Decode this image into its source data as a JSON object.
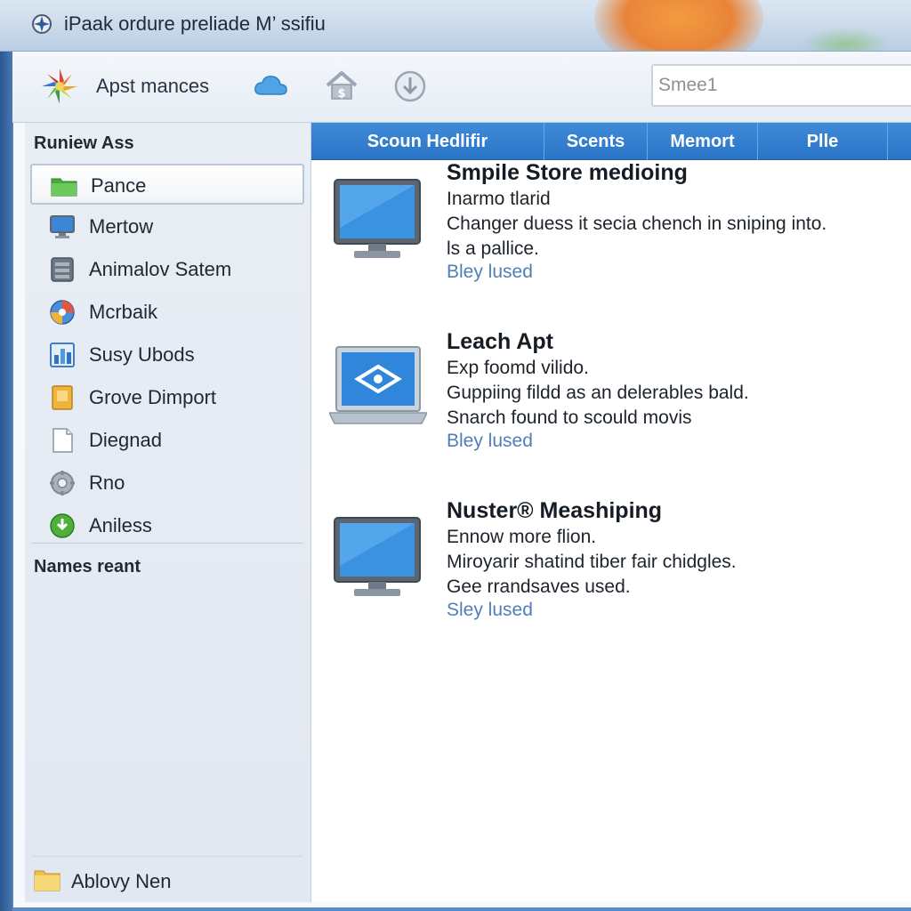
{
  "window": {
    "title": "iPaak ordure preliade M’ ssifiu"
  },
  "toolbar": {
    "app_label": "Apst mances",
    "search_placeholder": "Smee1",
    "icons": [
      "app-logo-icon",
      "cloud-icon",
      "home-icon",
      "download-icon"
    ]
  },
  "sidebar": {
    "heading": "Runiew Ass",
    "items": [
      {
        "label": "Pance",
        "icon": "folder-icon",
        "selected": true
      },
      {
        "label": "Mertow",
        "icon": "monitor-icon",
        "selected": false
      },
      {
        "label": "Animalov Satem",
        "icon": "drive-icon",
        "selected": false
      },
      {
        "label": "Mcrbaik",
        "icon": "globe-icon",
        "selected": false
      },
      {
        "label": "Susy Ubods",
        "icon": "chart-icon",
        "selected": false
      },
      {
        "label": "Grove Dimport",
        "icon": "notebook-icon",
        "selected": false
      },
      {
        "label": "Diegnad",
        "icon": "document-icon",
        "selected": false
      },
      {
        "label": "Rno",
        "icon": "gear-icon",
        "selected": false
      },
      {
        "label": "Aniless",
        "icon": "green-circle-icon",
        "selected": false
      }
    ],
    "section2_heading": "Names reant",
    "footer_label": "Ablovy Nen"
  },
  "tabs": [
    {
      "label": "Scoun  Hedlifir"
    },
    {
      "label": "Scents"
    },
    {
      "label": "Memort"
    },
    {
      "label": "Plle"
    }
  ],
  "entries": [
    {
      "title": "Smpile Store medioing",
      "lines": [
        "Inarmo tlarid",
        "Changer duess it secia chench in sniping into.",
        "ls a pallice."
      ],
      "link": "Bley lused",
      "icon": "monitor-icon"
    },
    {
      "title": "Leach Apt",
      "lines": [
        "Exp foomd vilido.",
        "Guppiing fildd as an delerables bald.",
        "Snarch found to scould movis"
      ],
      "link": "Bley lused",
      "icon": "laptop-icon"
    },
    {
      "title": "Nuster® Meashiping",
      "lines": [
        "Ennow more flion.",
        "Miroyarir shatind tiber fair chidgles.",
        "Gee rrandsaves used."
      ],
      "link": "Sley lused",
      "icon": "monitor-icon"
    }
  ],
  "colors": {
    "tab_bar": "#2a74c6",
    "link": "#4f7fb6",
    "desktop": "#2f5f9c"
  }
}
